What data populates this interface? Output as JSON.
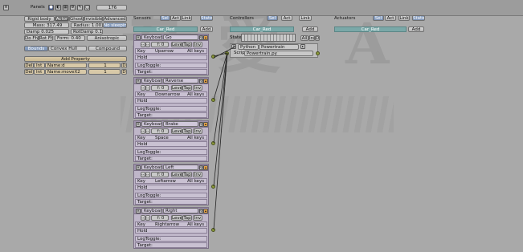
{
  "header": {
    "menu_icon": "menu-icon",
    "panels_label": "Panels",
    "frame": "176"
  },
  "object": {
    "tabs": [
      "Rigid body",
      "Actor",
      "Ghost",
      "Invisible",
      "Advanced"
    ],
    "mass": "Mass: 317.49",
    "radius": "Radius: 1.00",
    "no_sleeping": "No sleeping",
    "damp": "Damp 0.025",
    "rot_damp": "RotDamp 0.18",
    "do_fh": "Do Fh",
    "rot_fh": "Rot Fh",
    "form": "Form: 0.40",
    "anisotropic": "Anisotropic",
    "bounds": "Bounds",
    "bounds_type": "Convex Hull",
    "compound": "Compound",
    "add_property": "Add Property",
    "props": [
      {
        "del": "Del",
        "type": "Int",
        "name": "Name:d",
        "value": "1",
        "d": "D"
      },
      {
        "del": "Del",
        "type": "Int",
        "name": "Name:moveX2",
        "value": "1",
        "d": "D"
      }
    ]
  },
  "sensors": {
    "title": "Sensors",
    "sel": "Sel",
    "act": "Act",
    "link": "Link",
    "state": "State",
    "object": "Car_Red",
    "add": "Add",
    "items": [
      {
        "type": "Keyboard",
        "name": "Go",
        "key": "Uparrow"
      },
      {
        "type": "Keyboard",
        "name": "Reverse",
        "key": "Downarrow"
      },
      {
        "type": "Keyboard",
        "name": "Brake",
        "key": "Space"
      },
      {
        "type": "Keyboard",
        "name": "Left",
        "key": "Leftarrow"
      },
      {
        "type": "Keyboard",
        "name": "Right",
        "key": "Rightarrow"
      }
    ],
    "f_value": "f: 0",
    "level": "Level",
    "tap": "Tap",
    "inv": "Inv",
    "key_label": "Key",
    "all_keys": "All keys",
    "hold_label": "Hold",
    "logtoggle_label": "LogToggle:",
    "target_label": "Target:"
  },
  "controllers": {
    "title": "Controllers",
    "sel": "Sel",
    "act": "Act",
    "link": "Link",
    "object": "Car_Red",
    "add": "Add",
    "state_label": "State",
    "all_ini": "All",
    "ini": "Ini",
    "d": "D",
    "type": "Python",
    "name": "Powertrain",
    "script_label": "Script",
    "script": "Powertrain.py"
  },
  "actuators": {
    "title": "Actuators",
    "sel": "Sel",
    "act": "Act",
    "link": "Link",
    "state": "State",
    "object": "Car_Red",
    "add": "Add"
  },
  "colors": {
    "background": "#a9a9a9",
    "sensor_panel": "#bfb6c9",
    "object_header": "#7aa8a8",
    "connector": "#8c9a3a"
  }
}
